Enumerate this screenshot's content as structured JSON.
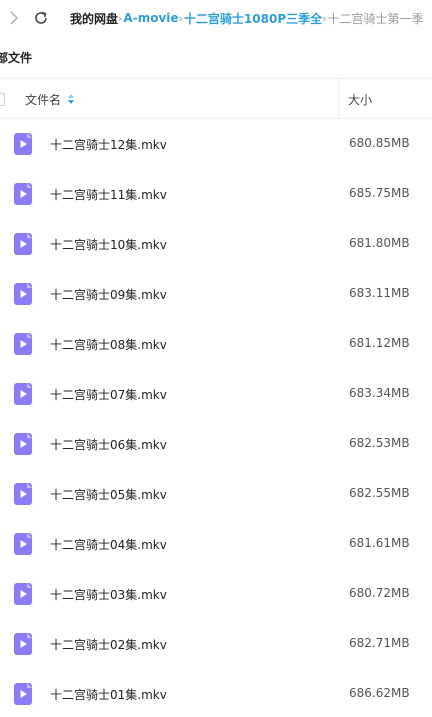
{
  "breadcrumb": {
    "items": [
      {
        "label": "我的网盘",
        "kind": "root"
      },
      {
        "label": "A-movie",
        "kind": "link"
      },
      {
        "label": "十二宫骑士1080P三季全",
        "kind": "link"
      },
      {
        "label": "十二宫骑士第一季",
        "kind": "current"
      }
    ],
    "separator": "›"
  },
  "section": {
    "title": "部文件"
  },
  "table": {
    "columns": {
      "name": "文件名",
      "size": "大小"
    },
    "sort_column": "name"
  },
  "files": [
    {
      "name": "十二宫骑士12集.mkv",
      "size": "680.85MB",
      "icon": "video-file-icon"
    },
    {
      "name": "十二宫骑士11集.mkv",
      "size": "685.75MB",
      "icon": "video-file-icon"
    },
    {
      "name": "十二宫骑士10集.mkv",
      "size": "681.80MB",
      "icon": "video-file-icon"
    },
    {
      "name": "十二宫骑士09集.mkv",
      "size": "683.11MB",
      "icon": "video-file-icon"
    },
    {
      "name": "十二宫骑士08集.mkv",
      "size": "681.12MB",
      "icon": "video-file-icon"
    },
    {
      "name": "十二宫骑士07集.mkv",
      "size": "683.34MB",
      "icon": "video-file-icon"
    },
    {
      "name": "十二宫骑士06集.mkv",
      "size": "682.53MB",
      "icon": "video-file-icon"
    },
    {
      "name": "十二宫骑士05集.mkv",
      "size": "682.55MB",
      "icon": "video-file-icon"
    },
    {
      "name": "十二宫骑士04集.mkv",
      "size": "681.61MB",
      "icon": "video-file-icon"
    },
    {
      "name": "十二宫骑士03集.mkv",
      "size": "680.72MB",
      "icon": "video-file-icon"
    },
    {
      "name": "十二宫骑士02集.mkv",
      "size": "682.71MB",
      "icon": "video-file-icon"
    },
    {
      "name": "十二宫骑士01集.mkv",
      "size": "686.62MB",
      "icon": "video-file-icon"
    }
  ],
  "colors": {
    "link": "#2e9fd8",
    "video_icon": "#8b7cf6",
    "divider": "#eceef2"
  }
}
